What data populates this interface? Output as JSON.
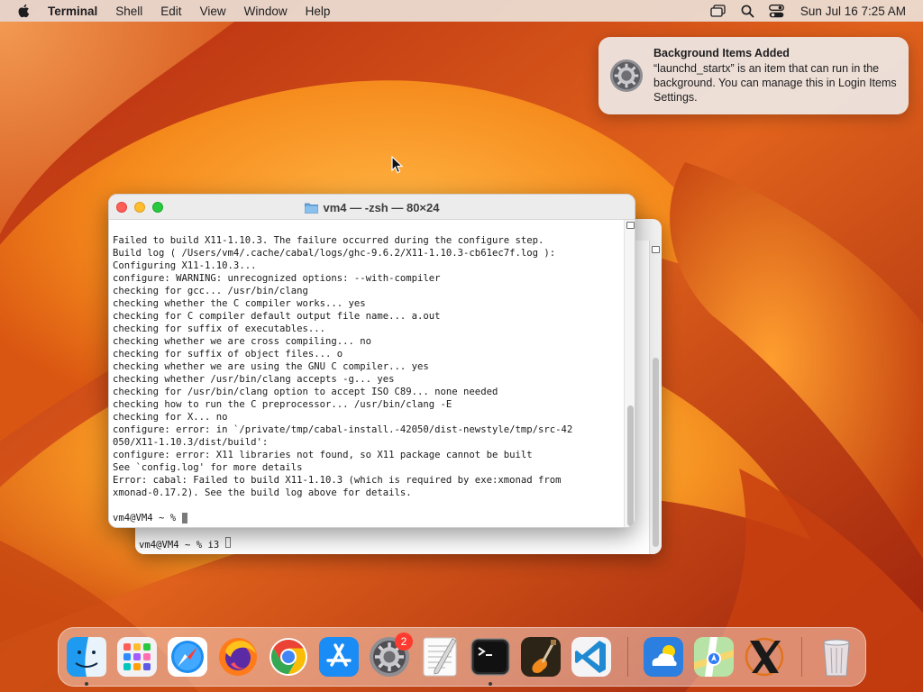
{
  "menubar": {
    "app_name": "Terminal",
    "menus": [
      "Shell",
      "Edit",
      "View",
      "Window",
      "Help"
    ],
    "clock": "Sun Jul 16  7:25 AM"
  },
  "notification": {
    "title": "Background Items Added",
    "body": "“launchd_startx” is an item that can run in the background. You can manage this in Login Items Settings."
  },
  "terminal_front": {
    "title": "vm4 — -zsh — 80×24",
    "lines": [
      "Failed to build X11-1.10.3. The failure occurred during the configure step.",
      "Build log ( /Users/vm4/.cache/cabal/logs/ghc-9.6.2/X11-1.10.3-cb61ec7f.log ):",
      "Configuring X11-1.10.3...",
      "configure: WARNING: unrecognized options: --with-compiler",
      "checking for gcc... /usr/bin/clang",
      "checking whether the C compiler works... yes",
      "checking for C compiler default output file name... a.out",
      "checking for suffix of executables...",
      "checking whether we are cross compiling... no",
      "checking for suffix of object files... o",
      "checking whether we are using the GNU C compiler... yes",
      "checking whether /usr/bin/clang accepts -g... yes",
      "checking for /usr/bin/clang option to accept ISO C89... none needed",
      "checking how to run the C preprocessor... /usr/bin/clang -E",
      "checking for X... no",
      "configure: error: in `/private/tmp/cabal-install.-42050/dist-newstyle/tmp/src-42",
      "050/X11-1.10.3/dist/build':",
      "configure: error: X11 libraries not found, so X11 package cannot be built",
      "See `config.log' for more details",
      "Error: cabal: Failed to build X11-1.10.3 (which is required by exe:xmonad from",
      "xmonad-0.17.2). See the build log above for details."
    ],
    "prompt": "vm4@VM4 ~ % "
  },
  "terminal_back": {
    "prompt": "vm4@VM4 ~ % i3 "
  },
  "dock": {
    "badge_count": "2",
    "items": [
      "finder-icon",
      "launchpad-icon",
      "safari-icon",
      "firefox-icon",
      "chrome-icon",
      "app-store-icon",
      "system-settings-icon",
      "textedit-icon",
      "terminal-icon",
      "garageband-icon",
      "vscode-icon",
      "weather-icon",
      "maps-icon",
      "xquartz-icon",
      "trash-icon"
    ]
  },
  "colors": {
    "accent_red": "#fe5f57",
    "accent_yellow": "#febc2e",
    "accent_green": "#28c840",
    "badge": "#ff3b30"
  }
}
